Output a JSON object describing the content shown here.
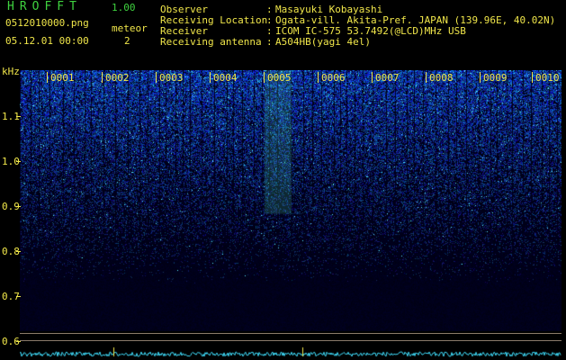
{
  "header": {
    "app_title": "HROFFT",
    "app_version": "1.00",
    "file_name": "0512010000.png",
    "date_time": "05.12.01 00:00",
    "meteor_label": "meteor",
    "meteor_count": "2"
  },
  "station_info": [
    {
      "label": "Observer",
      "value": "Masayuki Kobayashi"
    },
    {
      "label": "Receiving Location",
      "value": "Ogata-vill. Akita-Pref. JAPAN (139.96E, 40.02N)"
    },
    {
      "label": "Receiver",
      "value": "ICOM IC-575 53.7492(@LCD)MHz USB"
    },
    {
      "label": "Receiving antenna",
      "value": "A504HB(yagi 4el)"
    }
  ],
  "axis": {
    "unit_label": "kHz",
    "y_ticks": [
      "1.1",
      "1.0",
      "0.9",
      "0.8",
      "0.7",
      "0.6"
    ],
    "minute_labels": [
      "0001",
      "0002",
      "0003",
      "0004",
      "0005",
      "0006",
      "0007",
      "0008",
      "0009",
      "0010"
    ]
  },
  "colors": {
    "text_yellow": "#f0e64a",
    "title_green": "#3fd23f",
    "background": "#000000",
    "noise_blue": "#1e3cb4",
    "signal_cyan": "#40e0ff"
  }
}
